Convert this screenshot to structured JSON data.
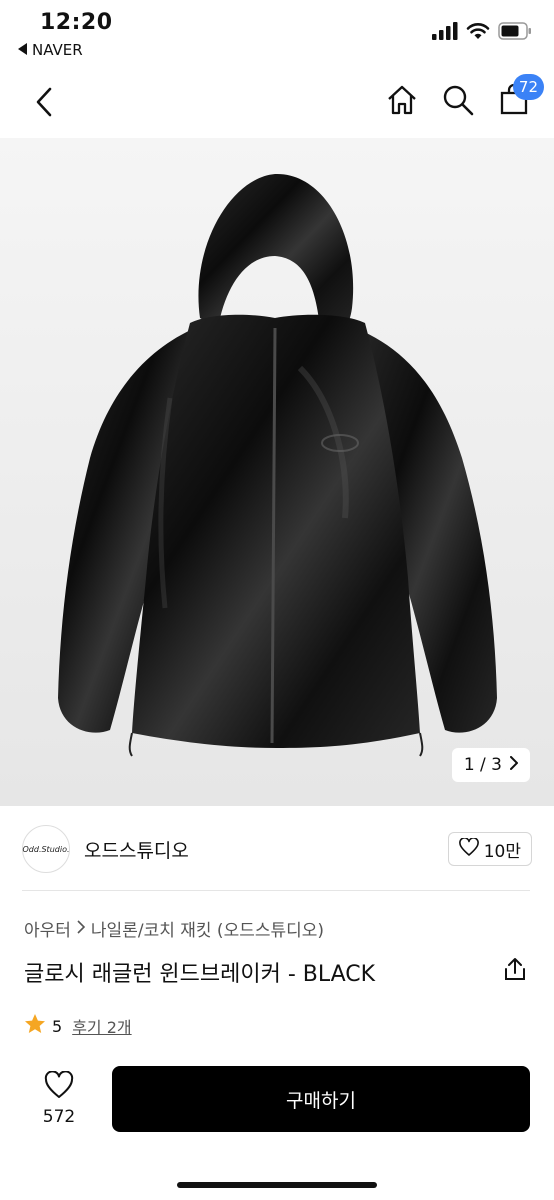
{
  "status_bar": {
    "time": "12:20",
    "back_app": "NAVER"
  },
  "nav": {
    "cart_count": "72"
  },
  "image": {
    "counter": "1 / 3"
  },
  "store": {
    "logo_text": "Odd.Studio.",
    "name": "오드스튜디오",
    "like_count": "10만"
  },
  "breadcrumb": {
    "level1": "아우터",
    "level2": "나일론/코치 재킷 (오드스튜디오)"
  },
  "product": {
    "title": "글로시 래글런 윈드브레이커 - BLACK"
  },
  "rating": {
    "score": "5",
    "reviews": "후기 2개"
  },
  "bottom_bar": {
    "wish_count": "572",
    "buy_label": "구매하기"
  },
  "colors": {
    "accent_badge": "#3b82f6",
    "star": "#f5a623",
    "buy_button": "#000000"
  }
}
